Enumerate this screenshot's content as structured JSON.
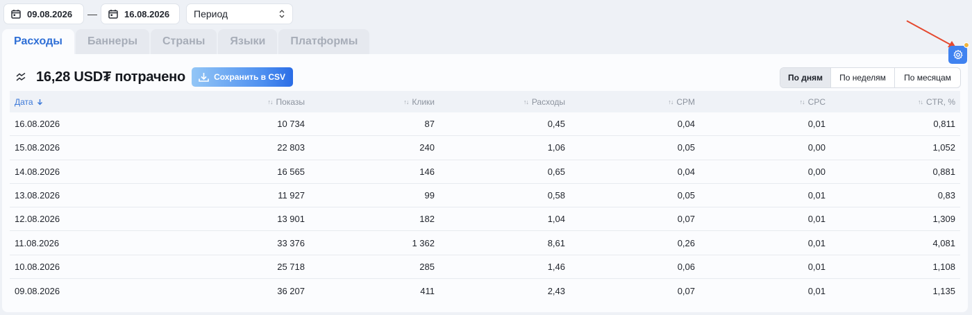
{
  "filters": {
    "date_from": "09.08.2026",
    "date_to": "16.08.2026",
    "separator": "—",
    "period_label": "Период"
  },
  "tabs": [
    {
      "label": "Расходы",
      "active": true
    },
    {
      "label": "Баннеры",
      "active": false
    },
    {
      "label": "Страны",
      "active": false
    },
    {
      "label": "Языки",
      "active": false
    },
    {
      "label": "Платформы",
      "active": false
    }
  ],
  "summary": {
    "text": "16,28 USD₮ потрачено",
    "csv_label": "Сохранить в CSV"
  },
  "grouping": [
    {
      "label": "По дням",
      "active": true
    },
    {
      "label": "По неделям",
      "active": false
    },
    {
      "label": "По месяцам",
      "active": false
    }
  ],
  "table": {
    "headers": [
      "Дата",
      "Показы",
      "Клики",
      "Расходы",
      "CPM",
      "CPC",
      "CTR, %"
    ],
    "rows": [
      [
        "16.08.2026",
        "10 734",
        "87",
        "0,45",
        "0,04",
        "0,01",
        "0,811"
      ],
      [
        "15.08.2026",
        "22 803",
        "240",
        "1,06",
        "0,05",
        "0,00",
        "1,052"
      ],
      [
        "14.08.2026",
        "16 565",
        "146",
        "0,65",
        "0,04",
        "0,00",
        "0,881"
      ],
      [
        "13.08.2026",
        "11 927",
        "99",
        "0,58",
        "0,05",
        "0,01",
        "0,83"
      ],
      [
        "12.08.2026",
        "13 901",
        "182",
        "1,04",
        "0,07",
        "0,01",
        "1,309"
      ],
      [
        "11.08.2026",
        "33 376",
        "1 362",
        "8,61",
        "0,26",
        "0,01",
        "4,081"
      ],
      [
        "10.08.2026",
        "25 718",
        "285",
        "1,46",
        "0,06",
        "0,01",
        "1,108"
      ],
      [
        "09.08.2026",
        "36 207",
        "411",
        "2,43",
        "0,07",
        "0,01",
        "1,135"
      ]
    ]
  },
  "icons": {
    "calendar": "calendar-icon",
    "settings": "gear-icon",
    "download": "download-icon",
    "trend": "trend-icon"
  },
  "colors": {
    "accent": "#2f6fd6",
    "settings_button": "#3f82f0",
    "notification_dot": "#f0b43c",
    "annotation_arrow": "#e5492f"
  }
}
